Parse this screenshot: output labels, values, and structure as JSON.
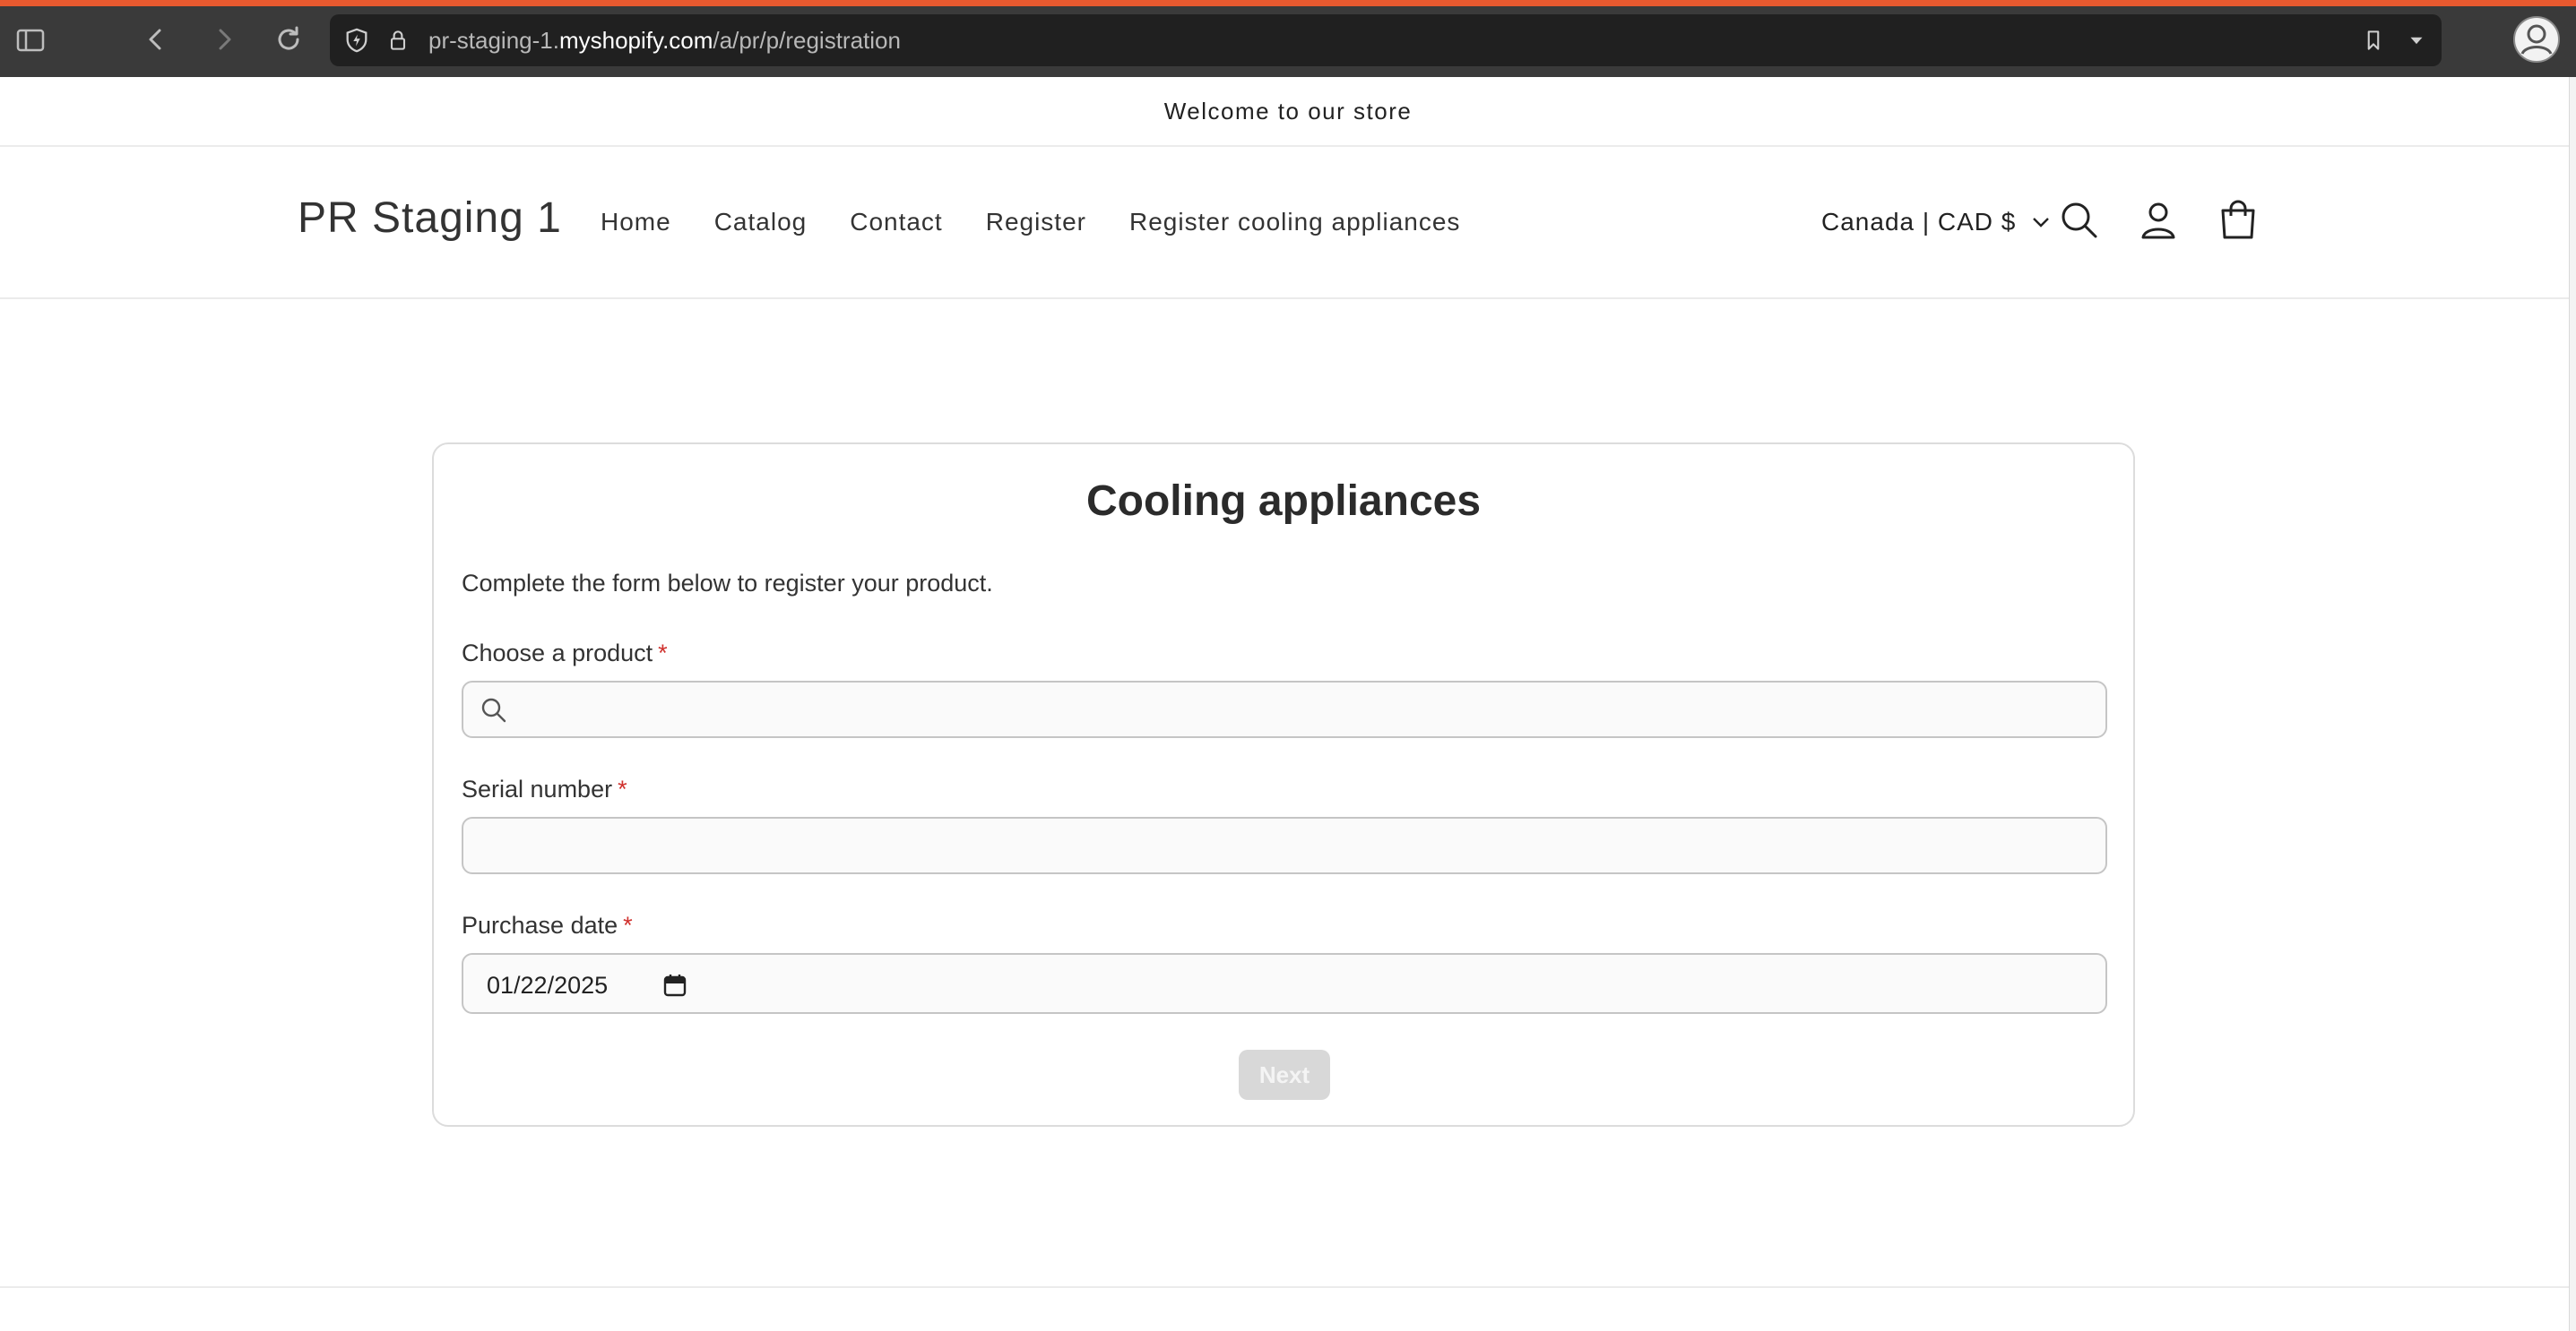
{
  "browser": {
    "url_prefix": "pr-staging-1.",
    "url_host": "myshopify.com",
    "url_path": "/a/pr/p/registration",
    "icons": [
      "sidebar-icon",
      "back-icon",
      "forward-icon",
      "reload-icon",
      "shield-icon",
      "lock-icon",
      "bookmark-icon",
      "dropdown-icon",
      "profile-icon"
    ],
    "accent_color": "#e8592f"
  },
  "announcement": {
    "text": "Welcome to our store"
  },
  "header": {
    "logo": "PR Staging 1",
    "nav": [
      "Home",
      "Catalog",
      "Contact",
      "Register",
      "Register cooling appliances"
    ],
    "country": "Canada | CAD $",
    "icons": [
      "search-icon",
      "account-icon",
      "cart-icon"
    ]
  },
  "form": {
    "title": "Cooling appliances",
    "intro": "Complete the form below to register your product.",
    "required_mark": "*",
    "product_label": "Choose a product",
    "product_value": "",
    "serial_label": "Serial number",
    "serial_value": "",
    "date_label": "Purchase date",
    "date_value": "01/22/2025",
    "next_label": "Next",
    "required_color": "#d0312d"
  }
}
